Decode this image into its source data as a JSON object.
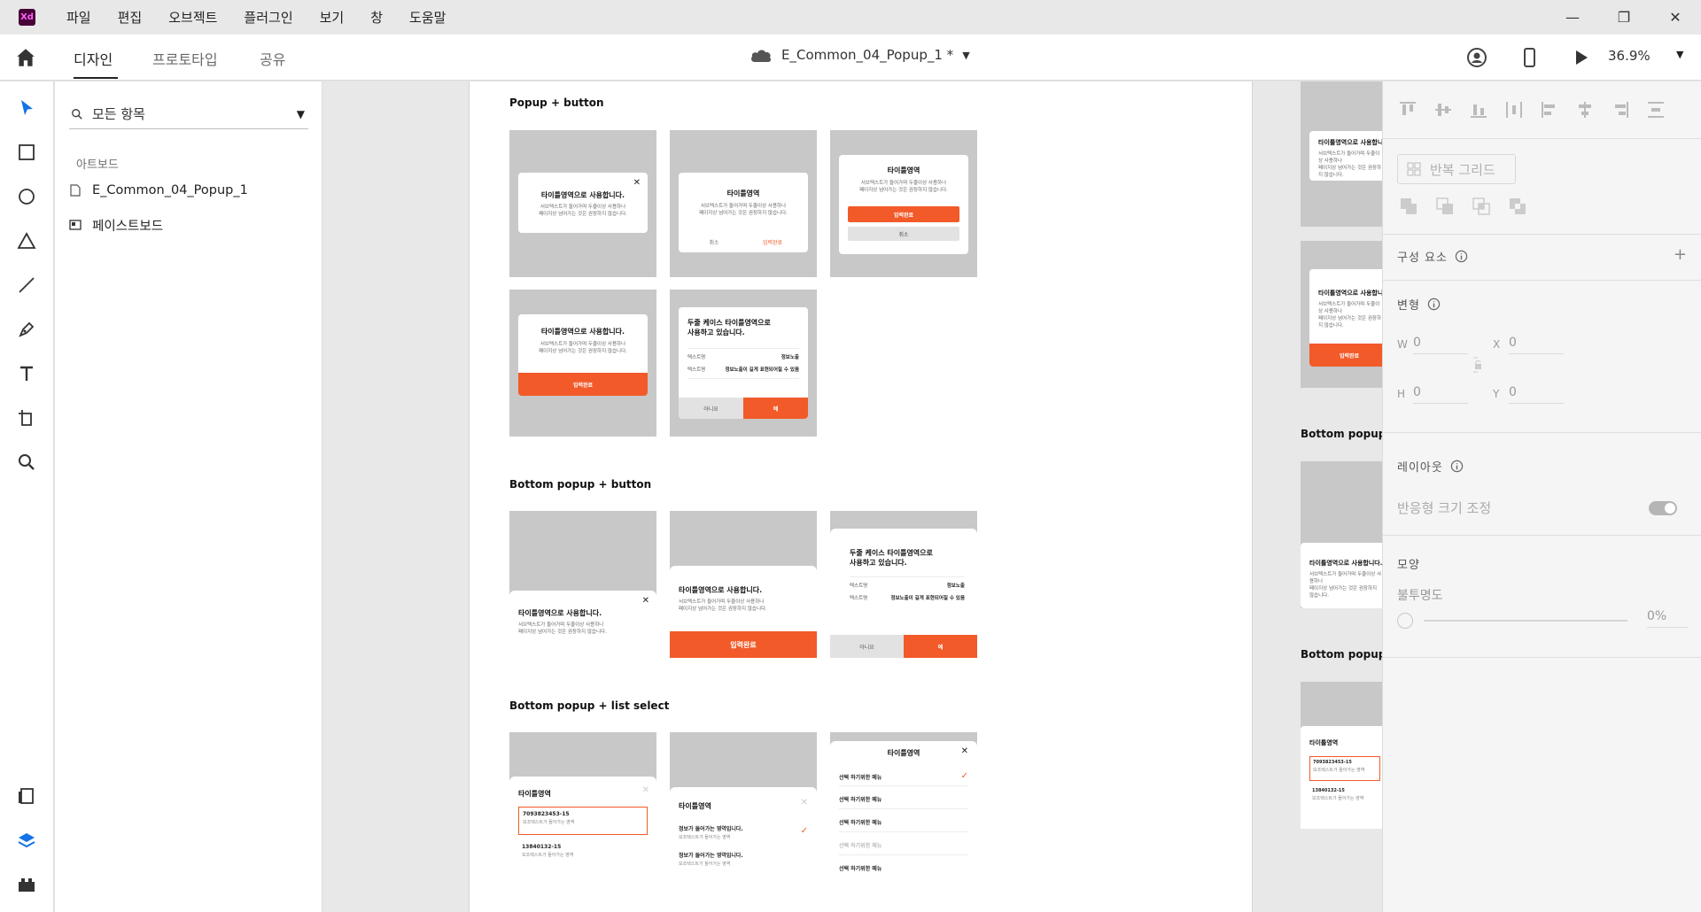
{
  "app": {
    "logo": "Xd"
  },
  "menu": [
    "파일",
    "편집",
    "오브젝트",
    "플러그인",
    "보기",
    "창",
    "도움말"
  ],
  "window_controls": {
    "minimize": "—",
    "restore": "❐",
    "close": "✕"
  },
  "toolbar": {
    "tabs": [
      "디자인",
      "프로토타입",
      "공유"
    ],
    "active_tab": "디자인",
    "document_title": "E_Common_04_Popup_1 *",
    "zoom": "36.9%"
  },
  "layers_panel": {
    "search_placeholder": "모든 항목",
    "section_label": "아트보드",
    "items": [
      "E_Common_04_Popup_1",
      "페이스트보드"
    ]
  },
  "canvas": {
    "sections": [
      {
        "title": "Popup + button"
      },
      {
        "title": "Bottom popup + button"
      },
      {
        "title": "Bottom popup + list select"
      }
    ],
    "popup": {
      "title_long": "타이틀영역으로 사용합니다.",
      "title_short": "타이틀영역",
      "body_1": "서브텍스트가 들어가며 두줄이상 사용하나",
      "body_2": "페이지상 넘어가는 것은 권장하지 않습니다.",
      "cancel": "취소",
      "confirm": "입력완료",
      "two_line_title_1": "두줄 케이스 타이틀영역으로",
      "two_line_title_2": "사용하고 있습니다.",
      "kv_label": "텍스트명",
      "kv_value_1": "정보노출",
      "kv_value_2": "정보노출이 길게 표현되어질 수 있음",
      "no": "아니요",
      "yes": "예"
    },
    "list_popup": {
      "item_1": "7093823453-15",
      "item_1_sub": "보조텍스트가 들어가는 영역",
      "item_2": "13840132-15",
      "item_2_sub": "보조텍스트가 들어가는 영역",
      "option_selected": "정보가 들어가는 영역입니다.",
      "option_sub": "보조텍스트가 들어가는 영역",
      "option_2": "정보가 들어가는 영역입니다.",
      "select_item": "선택 하기위한 메뉴"
    },
    "side_titles": [
      "Bottom popup +",
      "Bottom popup +"
    ]
  },
  "inspector": {
    "repeat_grid": "반복 그리드",
    "components": "구성 요소",
    "transform": "변형",
    "w_label": "W",
    "w_value": "0",
    "h_label": "H",
    "h_value": "0",
    "x_label": "X",
    "x_value": "0",
    "y_label": "Y",
    "y_value": "0",
    "layout": "레이아웃",
    "responsive_resize": "반응형 크기 조정",
    "appearance": "모양",
    "opacity": "불투명도",
    "opacity_value": "0%"
  }
}
